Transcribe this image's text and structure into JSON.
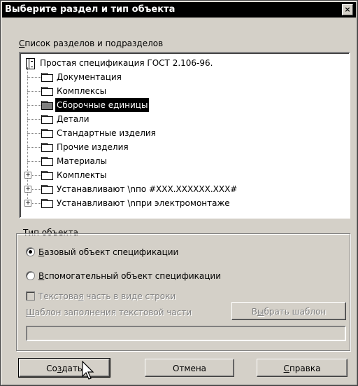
{
  "window": {
    "title": "Выберите раздел и тип объекта",
    "close_glyph": "×"
  },
  "list_label": {
    "accel": "С",
    "rest": "писок разделов и подразделов"
  },
  "tree": {
    "root": "Простая спецификация ГОСТ 2.106-96.",
    "items": [
      {
        "label": "Документация",
        "expandable": false,
        "selected": false
      },
      {
        "label": "Комплексы",
        "expandable": false,
        "selected": false
      },
      {
        "label": "Сборочные единицы",
        "expandable": false,
        "selected": true
      },
      {
        "label": "Детали",
        "expandable": false,
        "selected": false
      },
      {
        "label": "Стандартные изделия",
        "expandable": false,
        "selected": false
      },
      {
        "label": "Прочие изделия",
        "expandable": false,
        "selected": false
      },
      {
        "label": "Материалы",
        "expandable": false,
        "selected": false
      },
      {
        "label": "Комплекты",
        "expandable": true,
        "selected": false
      },
      {
        "label": "Устанавливают \\nпо #XXX.XXXXXX.XXX#",
        "expandable": true,
        "selected": false
      },
      {
        "label": "Устанавливают \\nпри электромонтаже",
        "expandable": true,
        "selected": false
      }
    ]
  },
  "object_type": {
    "legend": "Тип объекта",
    "base": {
      "accel": "Б",
      "rest": "азовый объект спецификации",
      "checked": true
    },
    "aux": {
      "accel": "В",
      "rest": "спомогательный объект спецификации",
      "checked": false
    },
    "text_part": {
      "pre": "Текстова",
      "accel": "я",
      "post": " часть в виде строки",
      "checked": false,
      "enabled": false
    },
    "template_label": {
      "accel": "Ш",
      "rest": "аблон заполнения текстовой части"
    },
    "choose_template": {
      "pre": "В",
      "accel": "ы",
      "post": "брать шаблон"
    },
    "template_value": ""
  },
  "buttons": {
    "create": {
      "pre": "Со",
      "accel": "з",
      "post": "дать"
    },
    "cancel": "Отмена",
    "help": {
      "accel": "С",
      "rest": "правка"
    }
  },
  "icons": {
    "root": "spec-book-icon",
    "item": "folder-icon",
    "expand": "plus-box-icon",
    "pointer": "mouse-cursor-icon"
  }
}
